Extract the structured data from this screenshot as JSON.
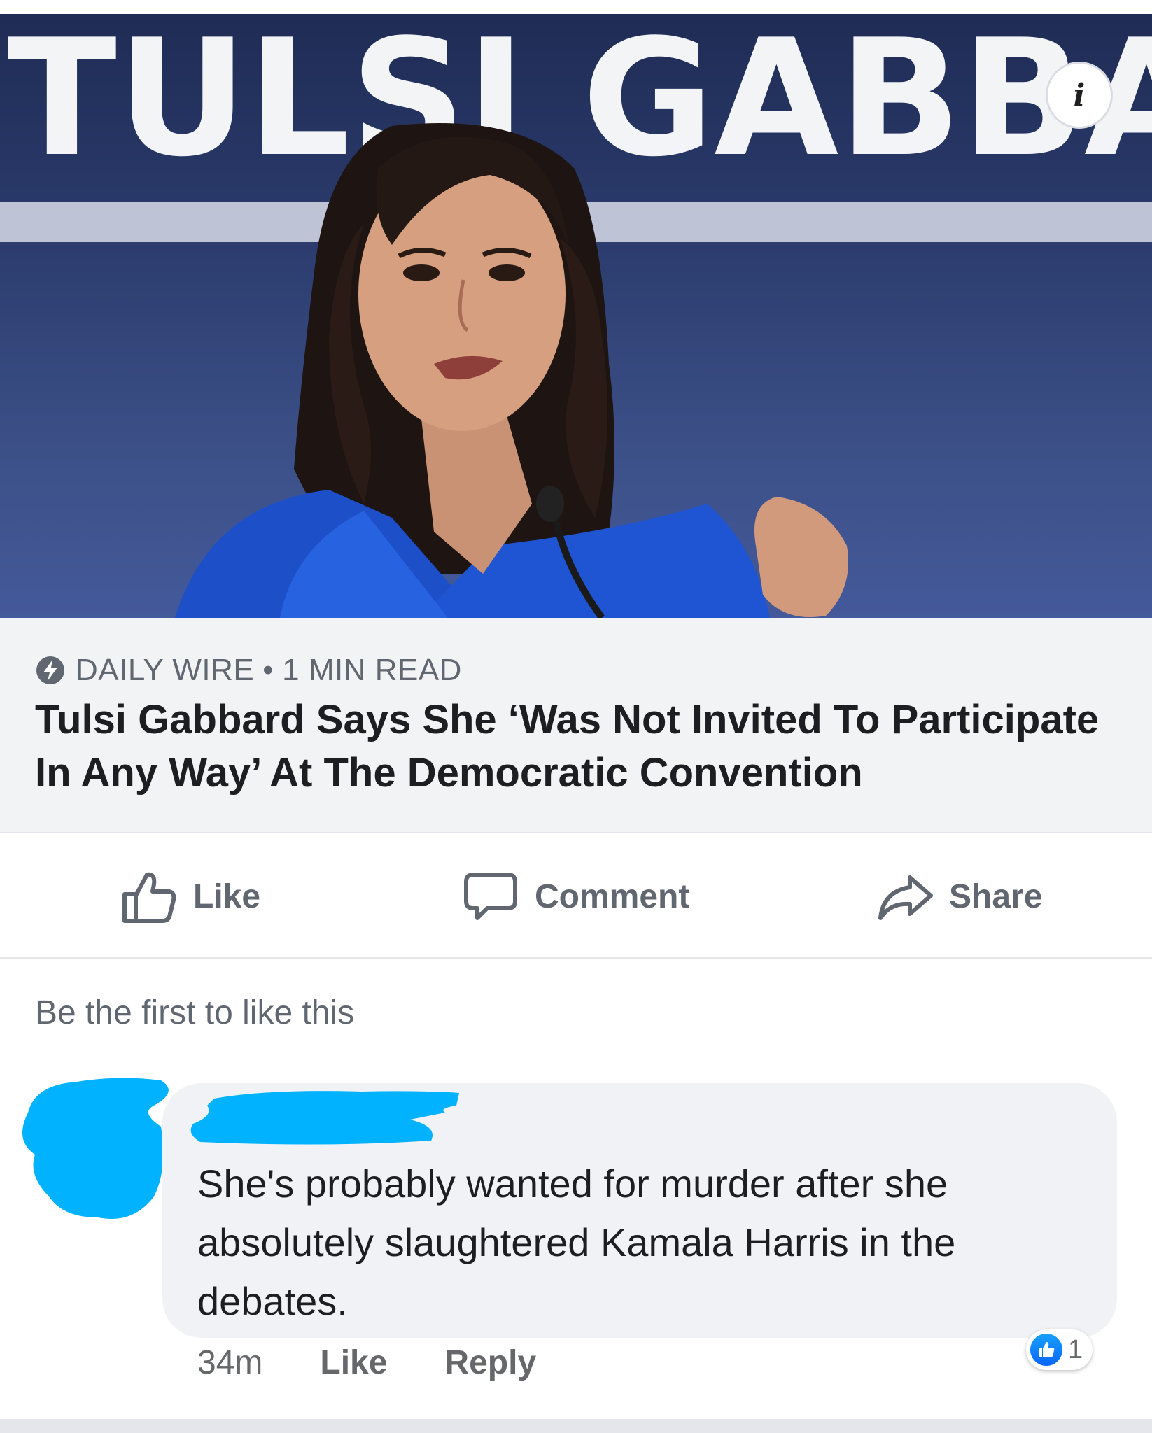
{
  "article": {
    "banner_text": "TULSI GABBARD",
    "info_icon": "info-icon",
    "source": "DAILY WIRE",
    "separator": "•",
    "read_time": "1 MIN READ",
    "headline": "Tulsi Gabbard Says She ‘Was Not Invited To Participate In Any Way’ At The Democratic Convention"
  },
  "actions": {
    "like": "Like",
    "comment": "Comment",
    "share": "Share"
  },
  "likes_summary": "Be the first to like this",
  "comment": {
    "text": "She's probably wanted for murder after she absolutely slaughtered Kamala Harris in the debates.",
    "time": "34m",
    "like_label": "Like",
    "reply_label": "Reply",
    "reaction_count": "1"
  },
  "colors": {
    "accent": "#0866ff",
    "redaction": "#00b2ff",
    "muted_text": "#606770"
  }
}
